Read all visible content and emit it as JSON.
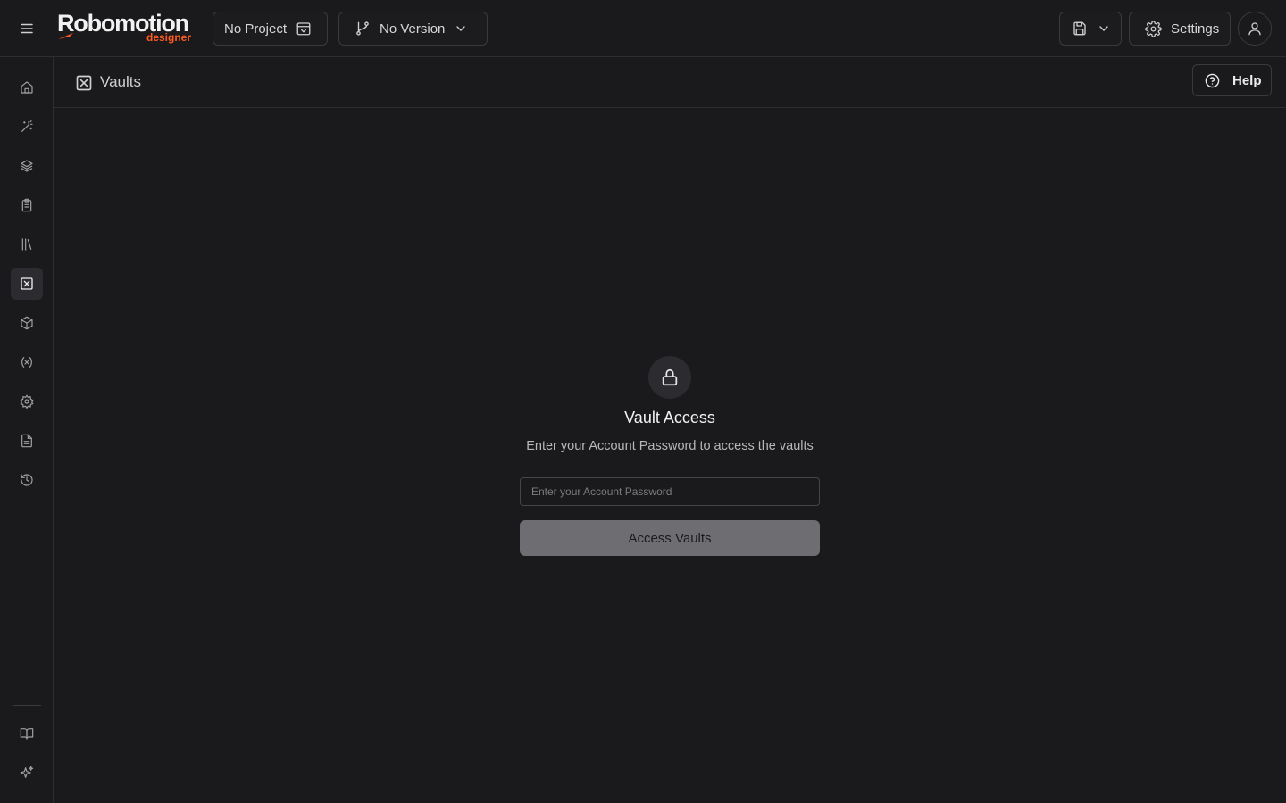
{
  "app": {
    "logo_text": "Robomotion",
    "logo_subtext": "designer",
    "brand_color": "#ff5a1f"
  },
  "topbar": {
    "menu_icon": "hamburger-icon",
    "project_label": "No Project",
    "project_icon": "calendar-check-icon",
    "version_label": "No Version",
    "version_icon": "git-branch-icon",
    "save_icon": "floppy-disk-icon",
    "settings_label": "Settings",
    "settings_icon": "gear-icon",
    "user_icon": "user-icon"
  },
  "sidebar": {
    "items": [
      {
        "icon": "home-icon",
        "active": false
      },
      {
        "icon": "magic-wand-icon",
        "active": false
      },
      {
        "icon": "layers-icon",
        "active": false
      },
      {
        "icon": "clipboard-icon",
        "active": false
      },
      {
        "icon": "library-icon",
        "active": false
      },
      {
        "icon": "vault-icon",
        "active": true
      },
      {
        "icon": "package-icon",
        "active": false
      },
      {
        "icon": "variable-icon",
        "active": false
      },
      {
        "icon": "gear-icon",
        "active": false
      },
      {
        "icon": "file-text-icon",
        "active": false
      },
      {
        "icon": "history-icon",
        "active": false
      }
    ],
    "bottom_items": [
      {
        "icon": "book-open-icon"
      },
      {
        "icon": "sparkles-icon"
      }
    ]
  },
  "header": {
    "title": "Vaults",
    "help_label": "Help"
  },
  "vault": {
    "title": "Vault Access",
    "description": "Enter your Account Password to access the vaults",
    "password_placeholder": "Enter your Account Password",
    "password_value": "",
    "access_button_label": "Access Vaults"
  }
}
